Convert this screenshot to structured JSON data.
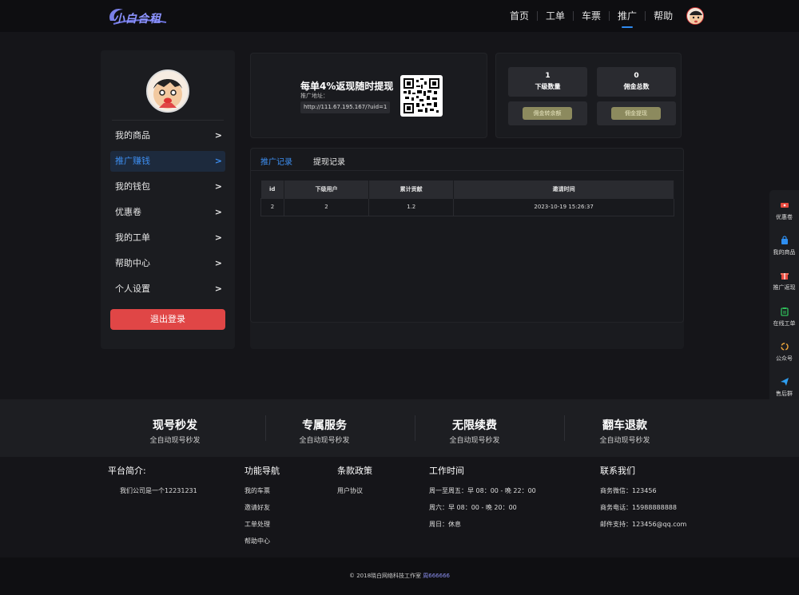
{
  "header": {
    "logo_text": "小白合租",
    "nav": [
      "首页",
      "工单",
      "车票",
      "推广",
      "帮助"
    ],
    "active_nav": "推广"
  },
  "sidebar": {
    "items": [
      {
        "label": "我的商品",
        "arrow": ">"
      },
      {
        "label": "推广赚钱",
        "arrow": ">"
      },
      {
        "label": "我的钱包",
        "arrow": ">"
      },
      {
        "label": "优惠卷",
        "arrow": ">"
      },
      {
        "label": "我的工单",
        "arrow": ">"
      },
      {
        "label": "帮助中心",
        "arrow": ">"
      },
      {
        "label": "个人设置",
        "arrow": ">"
      }
    ],
    "active_item": "推广赚钱",
    "logout_label": "退出登录"
  },
  "promo": {
    "title": "每单4%返现随时提现",
    "url_label": "推广地址：",
    "url": "http://111.67.195.167/?uid=1"
  },
  "stats": {
    "sub_count_value": "1",
    "sub_count_label": "下级数量",
    "commission_value": "0",
    "commission_label": "佣金总数",
    "transfer_button": "佣金转余额",
    "withdraw_button": "佣金提现"
  },
  "records": {
    "tabs": [
      "推广记录",
      "提现记录"
    ],
    "active_tab": "推广记录",
    "columns": [
      "id",
      "下级用户",
      "累计贡献",
      "邀请时间"
    ],
    "rows": [
      [
        "2",
        "2",
        "1.2",
        "2023-10-19 15:26:37"
      ]
    ]
  },
  "float_bar": {
    "items": [
      {
        "label": "优惠卷",
        "icon": "ticket-icon"
      },
      {
        "label": "我的商品",
        "icon": "bag-icon"
      },
      {
        "label": "推广返现",
        "icon": "gift-icon"
      },
      {
        "label": "在线工单",
        "icon": "clipboard-icon"
      },
      {
        "label": "公众号",
        "icon": "wechat-icon"
      },
      {
        "label": "售后群",
        "icon": "telegram-icon"
      }
    ]
  },
  "features": [
    {
      "title": "现号秒发",
      "subtitle": "全自动现号秒发"
    },
    {
      "title": "专属服务",
      "subtitle": "全自动现号秒发"
    },
    {
      "title": "无限续费",
      "subtitle": "全自动现号秒发"
    },
    {
      "title": "翻车退款",
      "subtitle": "全自动现号秒发"
    }
  ],
  "footer": {
    "about": {
      "heading": "平台简介:",
      "text": "我们公司是一个12231231"
    },
    "nav": {
      "heading": "功能导航",
      "links": [
        "我的车票",
        "邀请好友",
        "工单处理",
        "帮助中心"
      ]
    },
    "policy": {
      "heading": "条款政策",
      "links": [
        "用户协议"
      ]
    },
    "hours": {
      "heading": "工作时间",
      "lines": [
        "周一至周五：早 08：00 - 晚 22：00",
        "周六：早 08：00 - 晚 20：00",
        "周日：休息"
      ]
    },
    "contact": {
      "heading": "联系我们",
      "lines": [
        "商务微信：123456",
        "商务电话：15988888888",
        "邮件支持：123456@qq.com"
      ]
    },
    "copyright": "© 2018晓白网络科技工作室",
    "qq": "周666666"
  },
  "colors": {
    "accent": "#2f8bf0",
    "logout": "#e04646",
    "qq_link": "#8b8ff0"
  }
}
